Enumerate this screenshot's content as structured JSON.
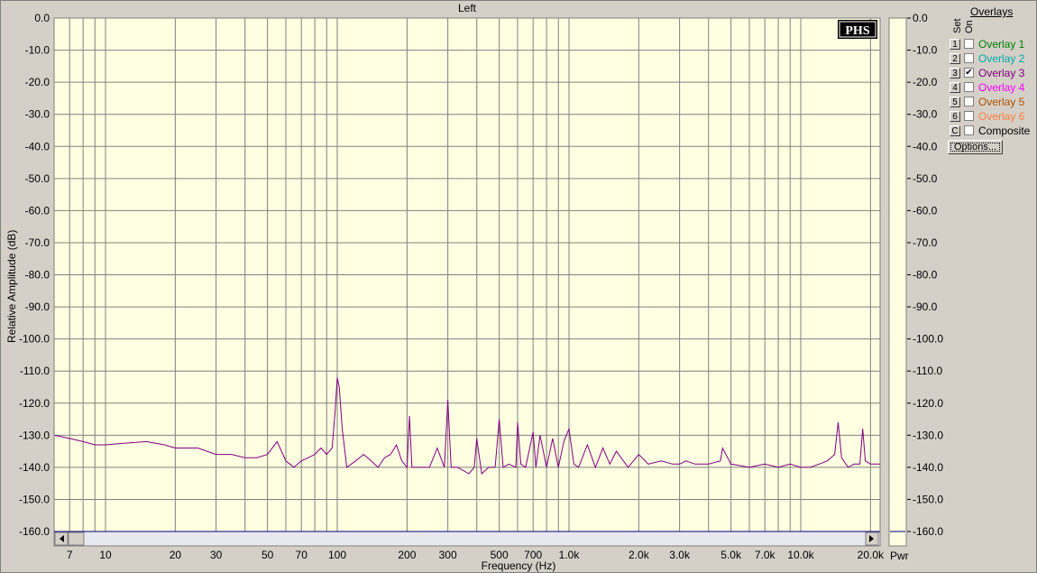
{
  "window": {
    "title": "Left"
  },
  "colors": {
    "plot_bg": "#ffffe1",
    "grid": "#808080",
    "trace": "#800080",
    "panel": "#d4d0c8"
  },
  "overlays": {
    "header": "Overlays",
    "set_label": "Set",
    "on_label": "On",
    "items": [
      {
        "set": "1",
        "name": "Overlay 1",
        "checked": false,
        "color": "#008000"
      },
      {
        "set": "2",
        "name": "Overlay 2",
        "checked": false,
        "color": "#00aaaa"
      },
      {
        "set": "3",
        "name": "Overlay 3",
        "checked": true,
        "color": "#800080"
      },
      {
        "set": "4",
        "name": "Overlay 4",
        "checked": false,
        "color": "#ff00ff"
      },
      {
        "set": "5",
        "name": "Overlay 5",
        "checked": false,
        "color": "#b05000"
      },
      {
        "set": "6",
        "name": "Overlay 6",
        "checked": false,
        "color": "#ff8040"
      },
      {
        "set": "C",
        "name": "Composite",
        "checked": false,
        "color": "#000000"
      }
    ],
    "options_label": "Options..."
  },
  "power_meter": {
    "label": "Pwr",
    "value_db": -160
  },
  "chart_data": {
    "type": "line",
    "title": "Left",
    "xlabel": "Frequency (Hz)",
    "ylabel": "Relative Amplitude (dB)",
    "x_scale": "log",
    "xlim": [
      6,
      22000
    ],
    "ylim": [
      -160,
      0
    ],
    "y_ticks": [
      "0.0",
      "-10.0",
      "-20.0",
      "-30.0",
      "-40.0",
      "-50.0",
      "-60.0",
      "-70.0",
      "-80.0",
      "-90.0",
      "-100.0",
      "-110.0",
      "-120.0",
      "-130.0",
      "-140.0",
      "-150.0",
      "-160.0"
    ],
    "x_ticks": [
      {
        "value": 7,
        "label": "7"
      },
      {
        "value": 10,
        "label": "10"
      },
      {
        "value": 20,
        "label": "20"
      },
      {
        "value": 30,
        "label": "30"
      },
      {
        "value": 50,
        "label": "50"
      },
      {
        "value": 70,
        "label": "70"
      },
      {
        "value": 100,
        "label": "100"
      },
      {
        "value": 200,
        "label": "200"
      },
      {
        "value": 300,
        "label": "300"
      },
      {
        "value": 500,
        "label": "500"
      },
      {
        "value": 700,
        "label": "700"
      },
      {
        "value": 1000,
        "label": "1.0k"
      },
      {
        "value": 2000,
        "label": "2.0k"
      },
      {
        "value": 3000,
        "label": "3.0k"
      },
      {
        "value": 5000,
        "label": "5.0k"
      },
      {
        "value": 7000,
        "label": "7.0k"
      },
      {
        "value": 10000,
        "label": "10.0k"
      },
      {
        "value": 20000,
        "label": "20.0k"
      }
    ],
    "grid": true,
    "series": [
      {
        "name": "Overlay 3",
        "x": [
          6,
          7,
          8,
          9,
          10,
          12,
          15,
          18,
          20,
          25,
          30,
          35,
          40,
          45,
          50,
          55,
          60,
          65,
          70,
          75,
          80,
          85,
          90,
          95,
          98,
          100,
          102,
          105,
          110,
          120,
          130,
          140,
          150,
          160,
          170,
          180,
          190,
          200,
          205,
          210,
          230,
          250,
          270,
          290,
          300,
          310,
          330,
          350,
          370,
          390,
          400,
          420,
          450,
          480,
          500,
          520,
          550,
          590,
          600,
          620,
          650,
          700,
          720,
          750,
          800,
          850,
          900,
          950,
          1000,
          1050,
          1100,
          1200,
          1300,
          1400,
          1500,
          1600,
          1800,
          2000,
          2200,
          2500,
          2800,
          3000,
          3200,
          3500,
          4000,
          4500,
          4600,
          5000,
          6000,
          7000,
          8000,
          9000,
          10000,
          11000,
          12000,
          13000,
          14000,
          14500,
          15000,
          16000,
          17000,
          18000,
          18500,
          19000,
          20000,
          22000
        ],
        "y": [
          -130,
          -131,
          -132,
          -133,
          -133,
          -132.5,
          -132,
          -133,
          -134,
          -134,
          -136,
          -136,
          -137,
          -137,
          -136,
          -132,
          -138,
          -140,
          -138,
          -137,
          -136,
          -134,
          -136,
          -134,
          -122,
          -112,
          -115,
          -128,
          -140,
          -138,
          -136,
          -138,
          -140,
          -137,
          -136,
          -133,
          -138,
          -140,
          -124,
          -140,
          -140,
          -140,
          -134,
          -140,
          -119,
          -140,
          -140,
          -141,
          -142,
          -140,
          -131,
          -142,
          -140,
          -140,
          -125,
          -140,
          -139,
          -140,
          -126,
          -139,
          -140,
          -129,
          -140,
          -130,
          -140,
          -131,
          -140,
          -132,
          -128,
          -139,
          -140,
          -133,
          -140,
          -134,
          -139,
          -135,
          -140,
          -136,
          -139,
          -138,
          -139,
          -139,
          -138,
          -139,
          -139,
          -138,
          -134,
          -139,
          -140,
          -139,
          -140,
          -139,
          -140,
          -140,
          -139,
          -138,
          -136,
          -126,
          -137,
          -140,
          -139,
          -139,
          -128,
          -138,
          -139,
          -139
        ]
      }
    ]
  }
}
